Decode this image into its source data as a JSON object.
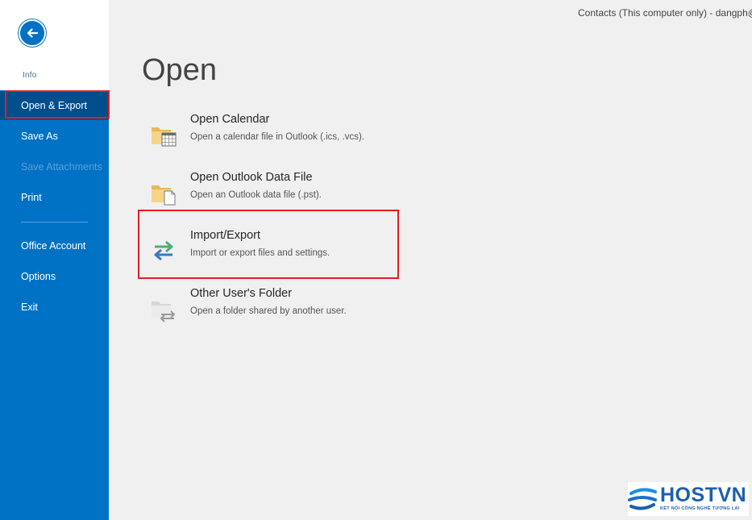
{
  "window": {
    "account_text": "Contacts (This computer only) - dangph@"
  },
  "sidebar": {
    "back_label": "",
    "info_label": "Info",
    "items": [
      {
        "label": "Open & Export",
        "state": "active"
      },
      {
        "label": "Save As",
        "state": "normal"
      },
      {
        "label": "Save Attachments",
        "state": "disabled"
      },
      {
        "label": "Print",
        "state": "normal"
      },
      {
        "label": "Office Account",
        "state": "normal"
      },
      {
        "label": "Options",
        "state": "normal"
      },
      {
        "label": "Exit",
        "state": "normal"
      }
    ]
  },
  "main": {
    "title": "Open",
    "options": [
      {
        "title": "Open Calendar",
        "description": "Open a calendar file in Outlook (.ics, .vcs).",
        "icon": "calendar-folder-icon"
      },
      {
        "title": "Open Outlook Data File",
        "description": "Open an Outlook data file (.pst).",
        "icon": "data-file-folder-icon"
      },
      {
        "title": "Import/Export",
        "description": "Import or export files and settings.",
        "icon": "import-export-arrows-icon"
      },
      {
        "title": "Other User's Folder",
        "description": "Open a folder shared by another user.",
        "icon": "shared-folder-icon"
      }
    ]
  },
  "watermark": {
    "brand": "HOSTVN",
    "tagline": "KẾT NỐI CÔNG NGHỆ TƯƠNG LAI"
  },
  "colors": {
    "sidebar": "#0072c6",
    "active_item": "#004e8c",
    "highlight": "#e21d24",
    "background": "#f0f0f0"
  }
}
